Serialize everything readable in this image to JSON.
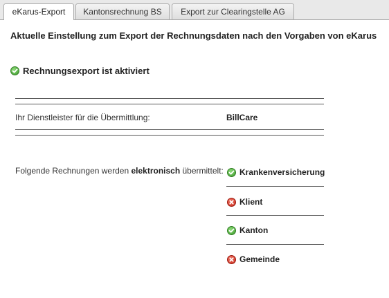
{
  "tabs": [
    {
      "label": "eKarus-Export",
      "active": true
    },
    {
      "label": "Kantonsrechnung BS",
      "active": false
    },
    {
      "label": "Export zur Clearingstelle AG",
      "active": false
    }
  ],
  "heading": "Aktuelle Einstellung zum Export der Rechnungsdaten nach den Vorgaben von eKarus",
  "status": {
    "text": "Rechnungsexport ist aktiviert",
    "icon": "check-circle-icon"
  },
  "provider": {
    "label": "Ihr Dienstleister für die Übermittlung:",
    "value": "BillCare"
  },
  "transmission": {
    "label_pre": "Folgende Rechnungen werden ",
    "label_bold": "elektronisch",
    "label_post": " übermittelt:",
    "recipients": [
      {
        "name": "Krankenversicherung",
        "enabled": true,
        "icon": "check-circle-icon"
      },
      {
        "name": "Klient",
        "enabled": false,
        "icon": "cross-circle-icon"
      },
      {
        "name": "Kanton",
        "enabled": true,
        "icon": "check-circle-icon"
      },
      {
        "name": "Gemeinde",
        "enabled": false,
        "icon": "cross-circle-icon"
      }
    ]
  },
  "colors": {
    "ok": "#3d9a2c",
    "error": "#c82617"
  }
}
